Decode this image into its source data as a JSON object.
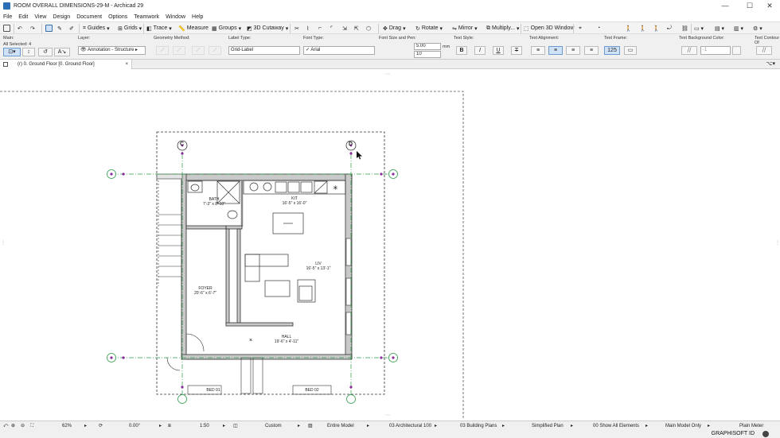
{
  "window": {
    "title": "ROOM OVERALL DIMENSIONS-29-M - Archicad 29",
    "controls": {
      "minimize": "—",
      "maximize": "☐",
      "close": "✕"
    }
  },
  "menu": [
    "File",
    "Edit",
    "View",
    "Design",
    "Document",
    "Options",
    "Teamwork",
    "Window",
    "Help"
  ],
  "toolbar": {
    "guides": "Guides",
    "grids": "Grids",
    "trace": "Trace",
    "measure": "Measure",
    "groups": "Groups",
    "cutaway": "3D Cutaway",
    "drag": "Drag",
    "rotate": "Rotate",
    "mirror": "Mirror",
    "multiply": "Multiply...",
    "open3d": "Open 3D Window"
  },
  "infobox": {
    "main_label": "Main:",
    "all_selected": "All Selected: 4",
    "layer_label": "Layer:",
    "layer_value": "Annotation - Structure",
    "geometry_label": "Geometry Method:",
    "label_type_label": "Label Type:",
    "label_type_value": "Grid-Label",
    "font_type_label": "Font Type:",
    "font_value": "Arial",
    "font_size_label": "Font Size and Pen:",
    "font_size_value": "5.00",
    "font_size_unit": "mm",
    "pen_value": "10",
    "text_style_label": "Text Style:",
    "bold": "B",
    "italic": "I",
    "underline": "U",
    "strike": "T",
    "text_align_label": "Text Alignment:",
    "text_frame_label": "Text Frame:",
    "text_frame_value": "125",
    "text_bg_label": "Text Background Color:",
    "text_bg_value": "-1",
    "text_contour_label": "Text Contour Of"
  },
  "tab": {
    "label": "[0. Ground Floor]",
    "prefix": "(r) 0. Ground Floor",
    "close": "×"
  },
  "plan": {
    "grid_bubbles": [
      "C",
      "D"
    ],
    "rooms": [
      {
        "name": "BATH",
        "size": "7'-3\" x 8'-10\""
      },
      {
        "name": "KIT",
        "size": "16'-5\" x 16'-0\""
      },
      {
        "name": "LIV",
        "size": "16'-5\" x 13'-1\""
      },
      {
        "name": "FOYER",
        "size": "20'-6\" x 6'-7\""
      },
      {
        "name": "HALL",
        "size": "19'-6\" x 4'-11\""
      },
      {
        "name": "BED 01",
        "size": ""
      },
      {
        "name": "BED 02",
        "size": ""
      }
    ]
  },
  "status": {
    "zoom": "62%",
    "angle": "0.00°",
    "scale": "1:50",
    "structure": "Custom",
    "model": "Entire Model",
    "pen_set": "03 Architectural 100",
    "model_view": "03 Building Plans",
    "partial": "Simplified Plan",
    "dims": "00 Show All Elements",
    "renovation": "Main Model Only",
    "units": "Plain Meter"
  },
  "brand": "GRAPHISOFT ID"
}
